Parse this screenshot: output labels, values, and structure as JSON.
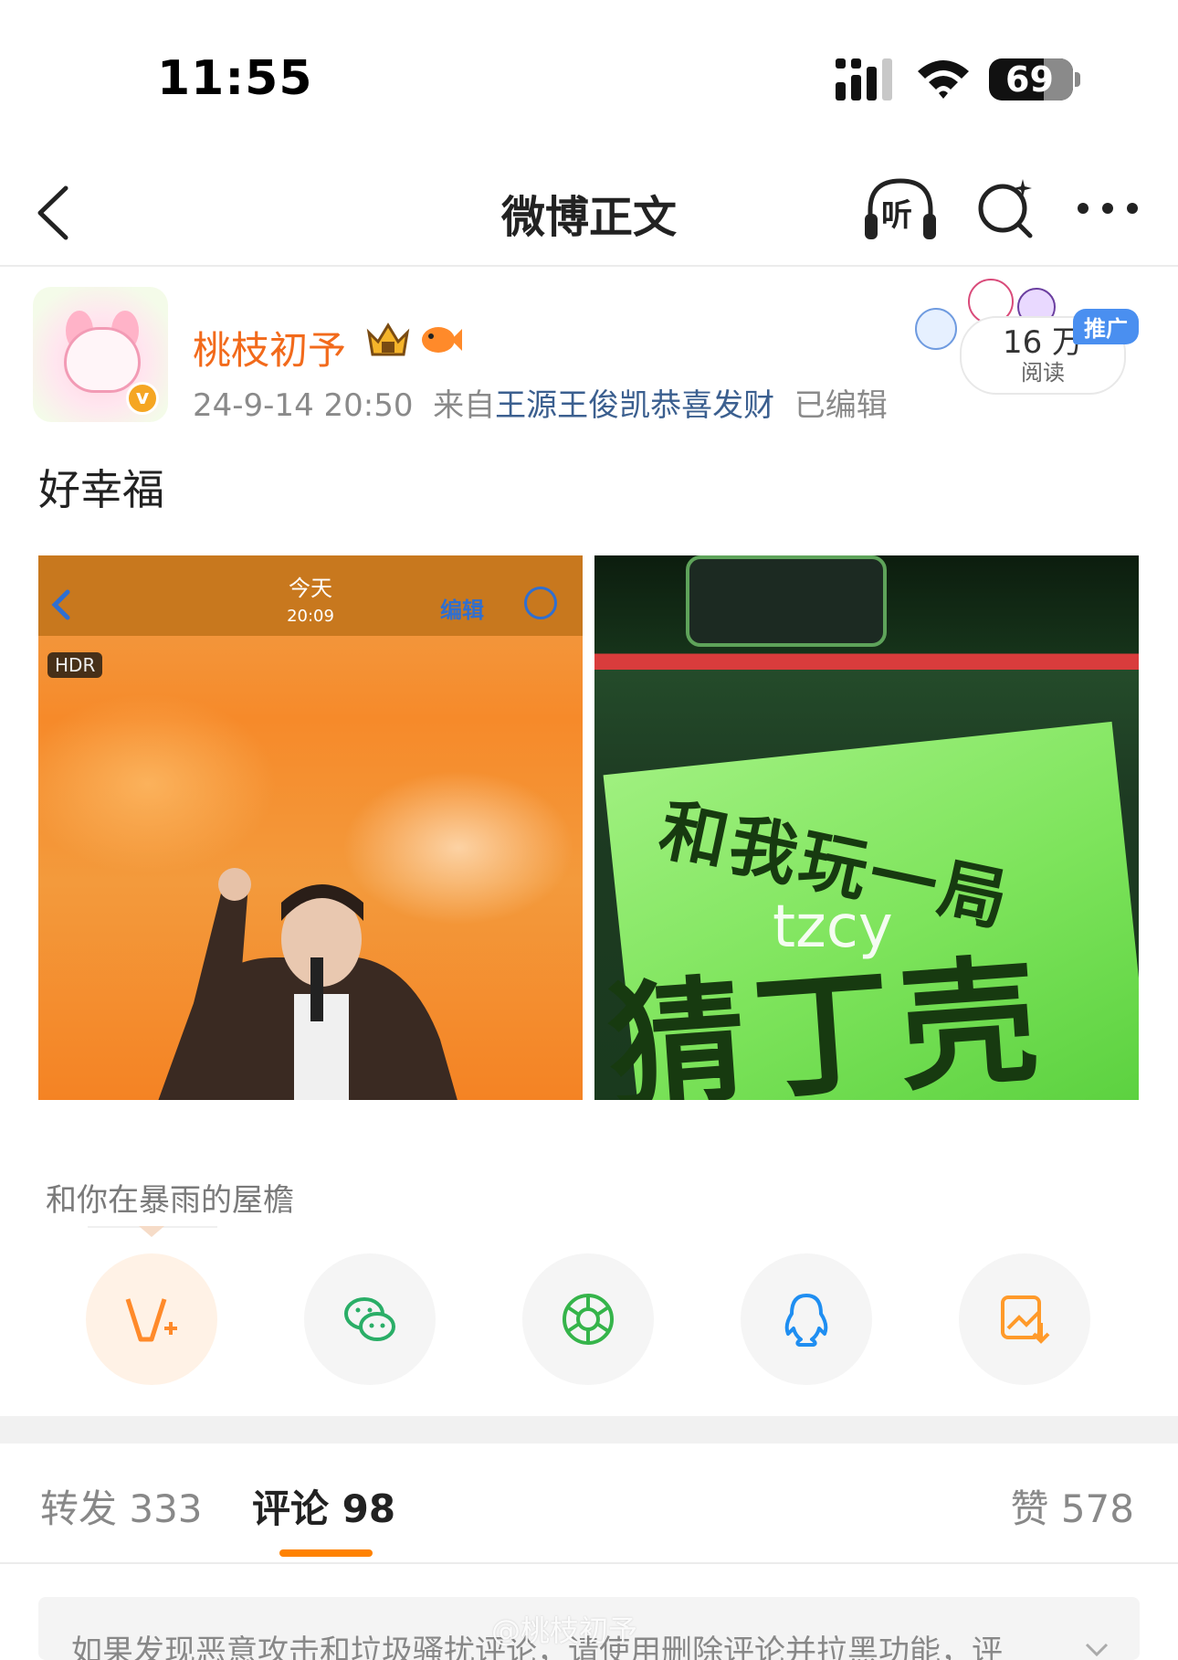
{
  "status_bar": {
    "time": "11:55",
    "battery": "69"
  },
  "nav": {
    "title": "微博正文",
    "listen_label": "听"
  },
  "post": {
    "author": "桃枝初予",
    "date": "24-9-14 20:50",
    "source_prefix": "来自",
    "source": "王源王俊凯恭喜发财",
    "edited": "已编辑",
    "text": "好幸福",
    "reads": {
      "value": "16 万",
      "label": "阅读",
      "tag": "推广"
    }
  },
  "images": [
    {
      "header_title": "今天",
      "header_time": "20:09",
      "edit_label": "编辑",
      "hdr_label": "HDR"
    },
    {
      "sign_line1": "和我玩一局",
      "sign_line2": "猜丁壳~",
      "overlay": "tzcy"
    }
  ],
  "music": {
    "text": "和你在暴雨的屋檐"
  },
  "share_icons": [
    "vplus-icon",
    "wechat-icon",
    "moments-icon",
    "qq-icon",
    "save-image-icon"
  ],
  "tabs": {
    "repost": "转发 333",
    "comment": "评论 98",
    "like": "赞 578"
  },
  "notice": {
    "text": "如果发现恶意攻击和垃圾骚扰评论，请使用删除评论并拉黑功能，评"
  },
  "watermark": "@桃枝初予",
  "colors": {
    "accent": "#ff8200",
    "name": "#f26a1b",
    "link": "#3b5f8f"
  }
}
